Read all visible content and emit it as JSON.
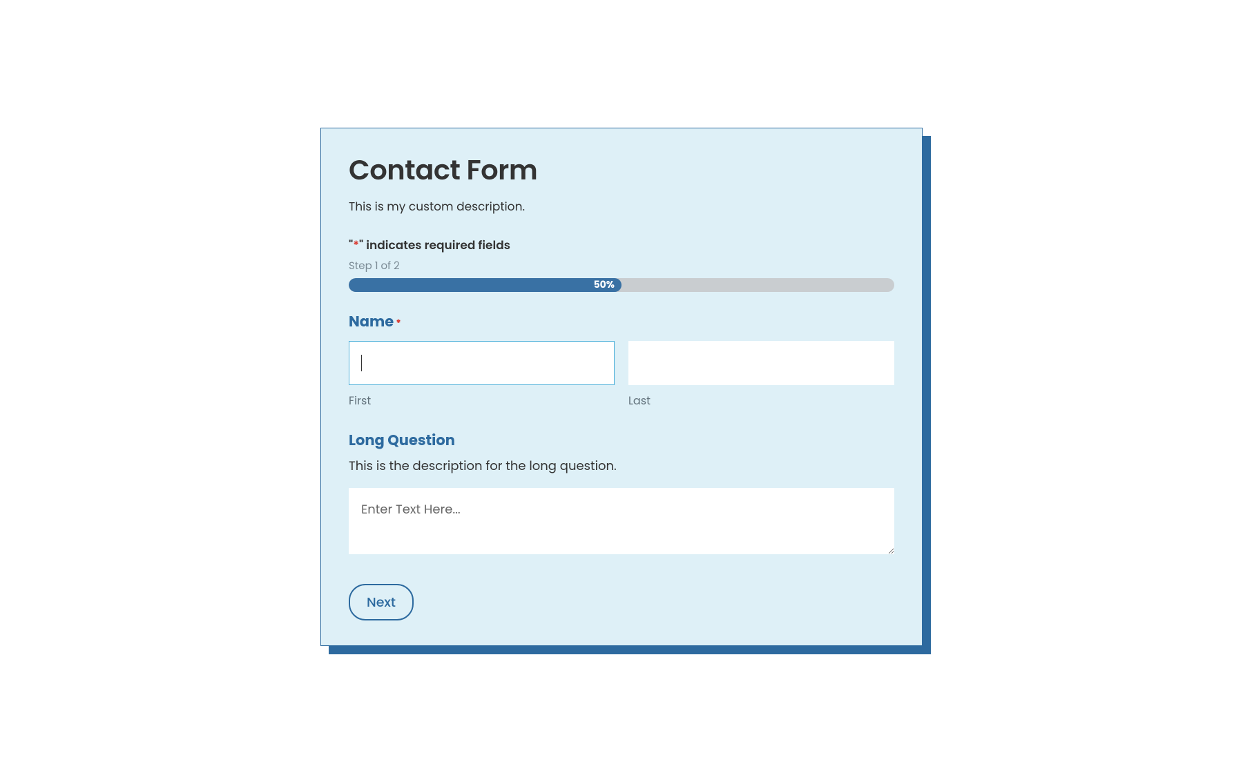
{
  "form": {
    "title": "Contact Form",
    "description": "This is my custom description.",
    "requiredNote": {
      "prefix": "\"",
      "asterisk": "*",
      "suffix": "\" indicates required fields"
    },
    "step": {
      "label": "Step 1 of 2",
      "percent": 50,
      "percentLabel": "50%"
    },
    "fields": {
      "name": {
        "label": "Name",
        "required": true,
        "first": {
          "sublabel": "First",
          "value": ""
        },
        "last": {
          "sublabel": "Last",
          "value": ""
        }
      },
      "longQuestion": {
        "label": "Long Question",
        "description": "This is the description for the long question.",
        "placeholder": "Enter Text Here...",
        "value": ""
      }
    },
    "nextButton": "Next"
  }
}
